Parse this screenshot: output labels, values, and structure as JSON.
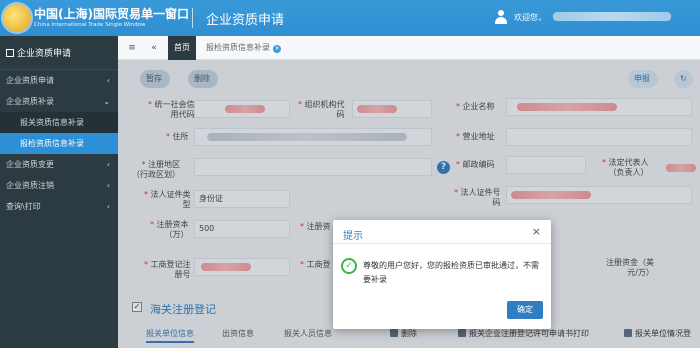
{
  "header": {
    "brand_cn": "中国(上海)国际贸易单一窗口",
    "brand_en": "China International Trade Single Window",
    "title": "企业资质申请",
    "welcome": "欢迎您，"
  },
  "sidebar": {
    "title": "企业资质申请",
    "items": [
      {
        "label": "企业资质申请",
        "chevron": "‹"
      },
      {
        "label": "企业资质补录",
        "chevron": "⌄"
      },
      {
        "label": "报关资质信息补录"
      },
      {
        "label": "报检资质信息补录"
      },
      {
        "label": "企业资质变更",
        "chevron": "‹"
      },
      {
        "label": "企业资质注销",
        "chevron": "‹"
      },
      {
        "label": "查询\\打印",
        "chevron": "‹"
      }
    ]
  },
  "tabbar": {
    "menu_icon": "≡",
    "back_icon": "«",
    "home_tab": "首页",
    "current_tab": "报检资质信息补录",
    "close_icon": "×"
  },
  "toolbar": {
    "save_label": "暂存",
    "delete_label": "删除",
    "declare_label": "申报",
    "refresh_icon": "↻"
  },
  "form": {
    "credit_code_label": "统一社会信\n用代码",
    "org_code_label": "组织机构代\n码",
    "company_name_label": "企业名称",
    "address_label": "住所",
    "business_address_label": "营业地址",
    "reg_area_label": "注册地区\n（行政区划）",
    "postal_code_label": "邮政编码",
    "legal_rep_label": "法定代表人\n（负责人）",
    "cert_type_label": "法人证件类\n型",
    "cert_type_value": "身份证",
    "cert_no_label": "法人证件号\n码",
    "reg_capital_label": "注册资本\n（万）",
    "reg_capital_value": "500",
    "reg_capital2_label": "注册资",
    "biz_reg_no_label": "工商登记注\n册号",
    "biz_reg_label2": "工商登",
    "reg_fund_label": "注册资金（美\n元/万）",
    "help_icon": "?"
  },
  "section": {
    "checkbox": "✓",
    "title": "海关注册登记",
    "subtabs": [
      "报关单位信息",
      "出资信息",
      "报关人员信息"
    ],
    "delete_btn": "删除",
    "print_btn1": "报关企业注册登记许可申请书打印",
    "print_btn2": "报关单位情况登"
  },
  "modal": {
    "title": "提示",
    "close_icon": "×",
    "message": "尊敬的用户您好，您的报检资质已审批通过，不需要补录",
    "ok_icon": "✓",
    "ok_label": "确定"
  },
  "colors": {
    "header_blue": "#2f8ed0",
    "sidebar_dark": "#2c3b41",
    "active_blue": "#2d8fd6",
    "success_green": "#3bb54a"
  }
}
